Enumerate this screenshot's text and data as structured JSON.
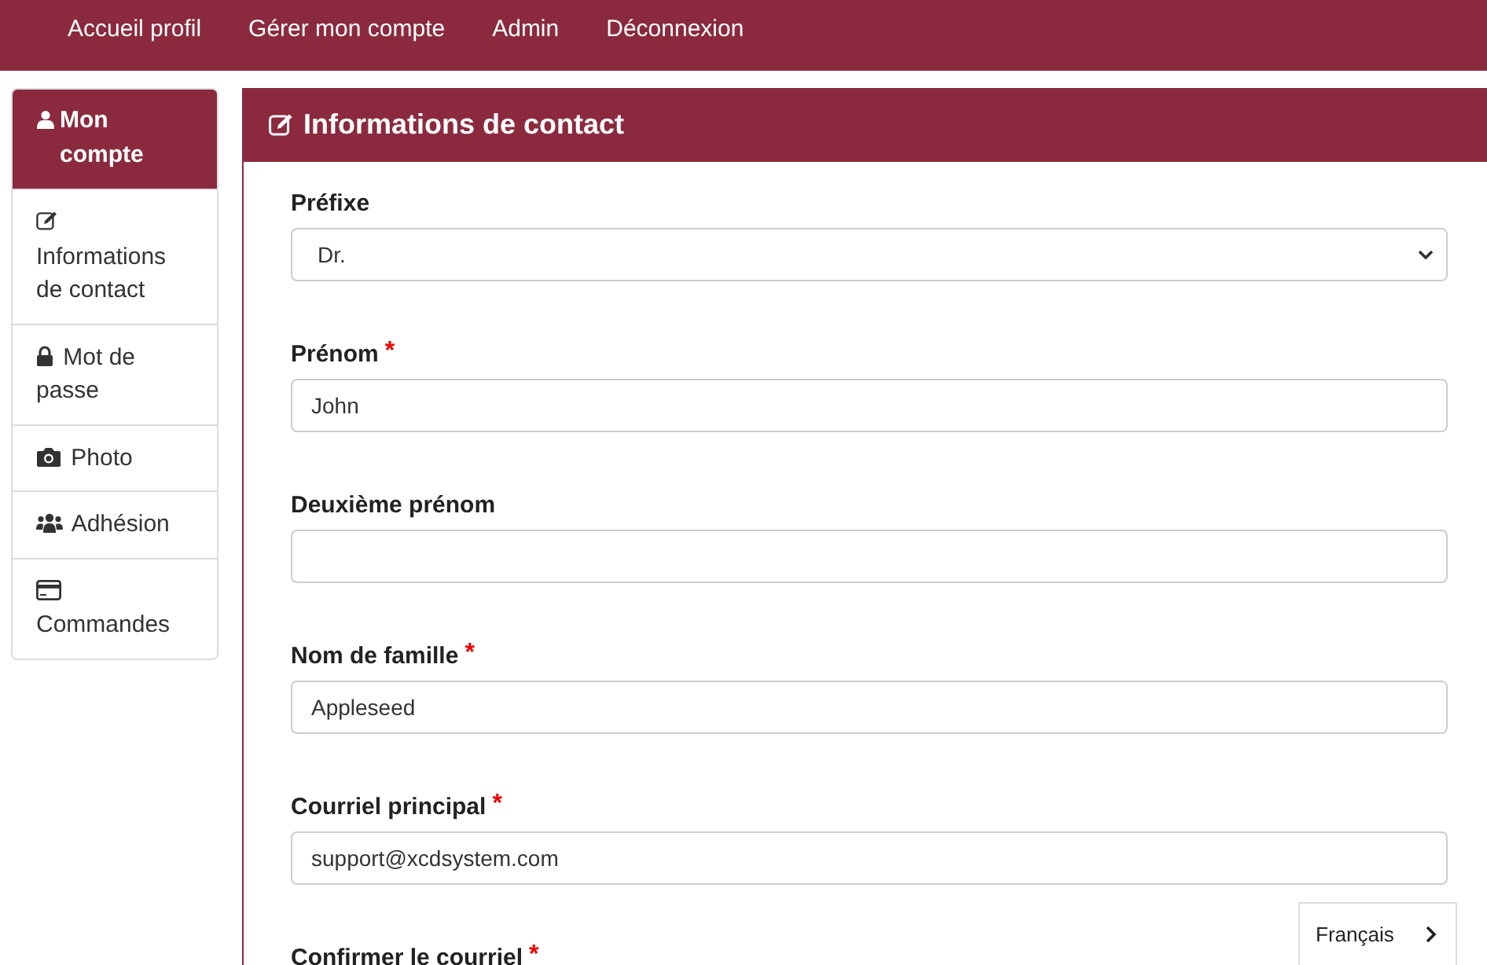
{
  "nav": {
    "links": [
      "Accueil profil",
      "Gérer mon compte",
      "Admin",
      "Déconnexion"
    ]
  },
  "sidebar": {
    "title": "Mon compte",
    "items": [
      {
        "label": "Informations de contact"
      },
      {
        "label": "Mot de passe"
      },
      {
        "label": "Photo"
      },
      {
        "label": "Adhésion"
      },
      {
        "label": "Commandes"
      }
    ]
  },
  "panel": {
    "title": "Informations de contact",
    "fields": [
      {
        "kind": "select",
        "label": "Préfixe",
        "value": "Dr."
      },
      {
        "kind": "text",
        "label": "Prénom",
        "required_mark": "*",
        "value": "John"
      },
      {
        "kind": "text",
        "label": "Deuxième prénom"
      },
      {
        "kind": "text",
        "label": "Nom de famille",
        "required_mark": "*",
        "value": "Appleseed"
      },
      {
        "kind": "text",
        "label": "Courriel principal",
        "required_mark": "*",
        "value": "support@xcdsystem.com"
      },
      {
        "kind": "label",
        "label": "Confirmer le courriel",
        "required_mark": "*"
      }
    ]
  },
  "language": {
    "label": "Français"
  }
}
